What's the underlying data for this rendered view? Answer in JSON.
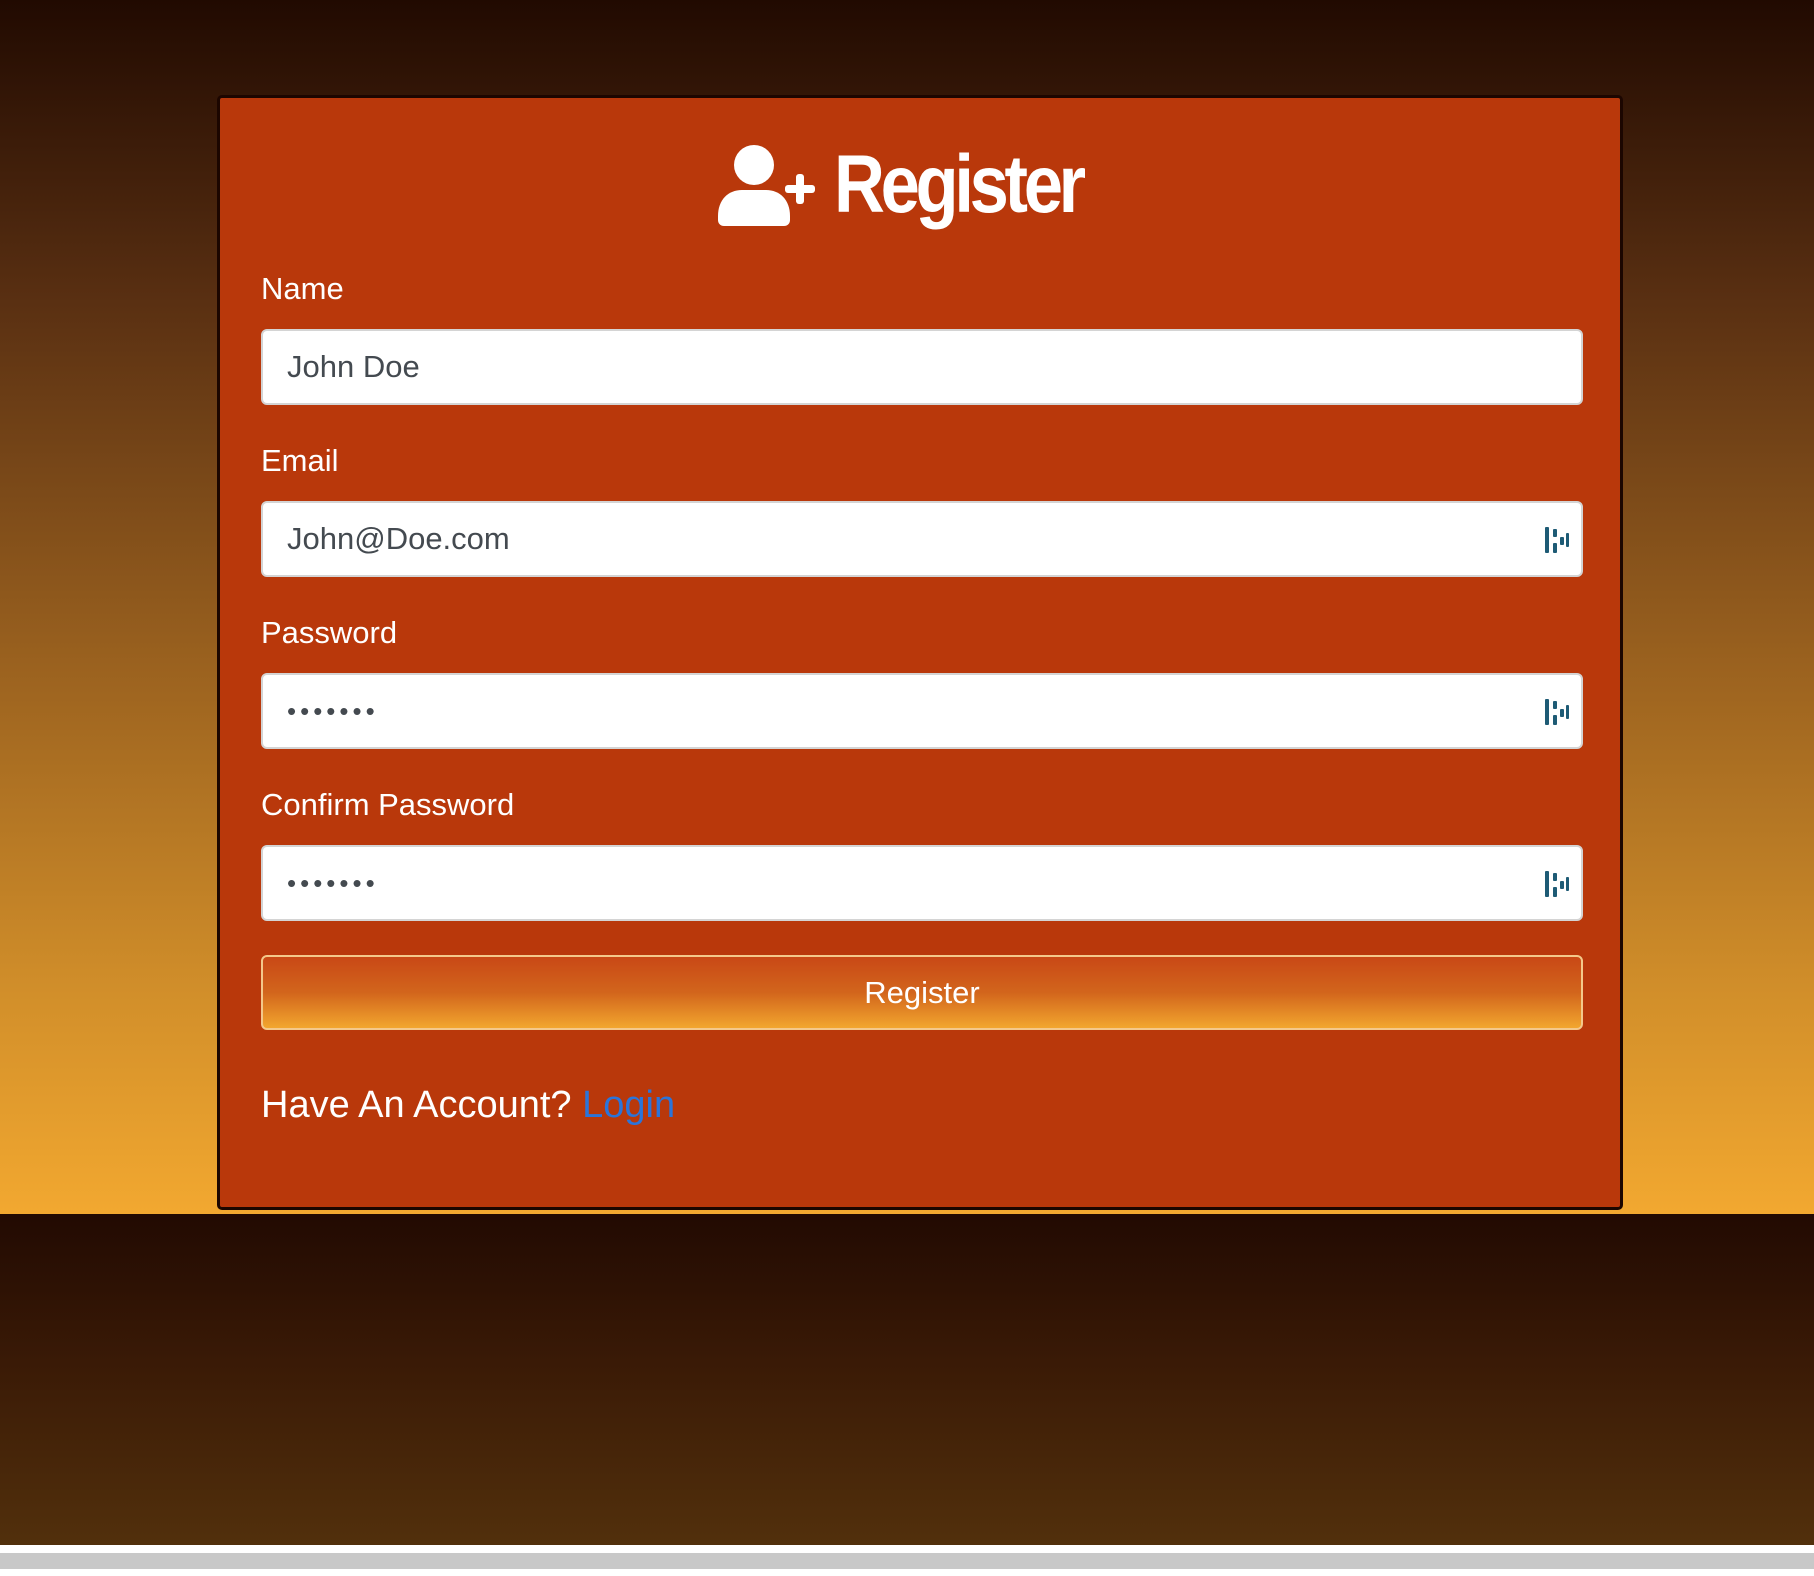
{
  "register_form": {
    "title": "Register",
    "title_icon": "user-plus-icon",
    "fields": [
      {
        "label": "Name",
        "value": "John Doe",
        "type": "text",
        "password_manager_icon": false
      },
      {
        "label": "Email",
        "value": "John@Doe.com",
        "type": "email",
        "password_manager_icon": true
      },
      {
        "label": "Password",
        "value": "•••••••",
        "type": "password",
        "password_manager_icon": true
      },
      {
        "label": "Confirm Password",
        "value": "•••••••",
        "type": "password",
        "password_manager_icon": true
      }
    ],
    "submit_label": "Register",
    "account_prompt": "Have An Account?",
    "login_link": "Login"
  },
  "colors": {
    "card_background": "#b9380b",
    "link": "#2b74d9",
    "button_gradient_top": "#c94816",
    "button_gradient_bottom": "#f2a62e",
    "password_manager_icon": "#1e5b75"
  }
}
